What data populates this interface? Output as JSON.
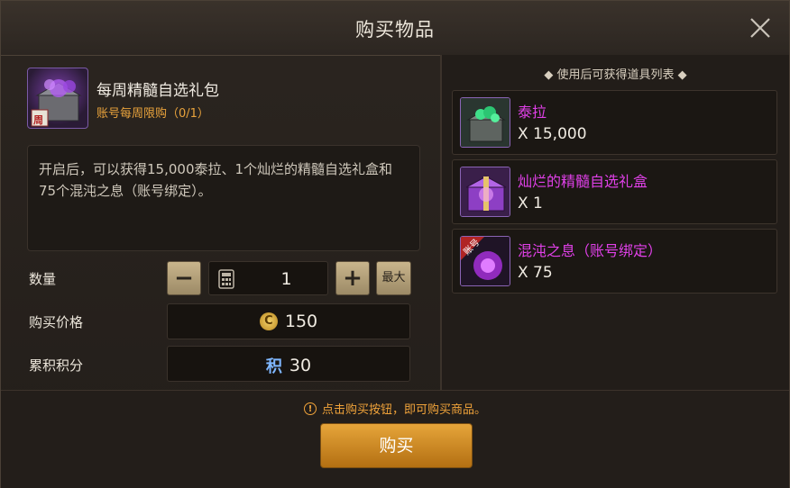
{
  "header": {
    "title": "购买物品"
  },
  "item": {
    "name": "每周精髓自选礼包",
    "limit": "账号每周限购（0/1）",
    "icon_badge": "周",
    "description": "开启后，可以获得15,000泰拉、1个灿烂的精髓自选礼盒和75个混沌之息（账号绑定）。"
  },
  "quantity": {
    "label": "数量",
    "value": "1",
    "minus": "−",
    "plus": "+",
    "max_label": "最大"
  },
  "price": {
    "label": "购买价格",
    "value": "150",
    "currency_glyph": "C"
  },
  "points": {
    "label": "累积积分",
    "value": "30",
    "points_glyph": "积"
  },
  "rewards": {
    "title": "◆ 使用后可获得道具列表 ◆",
    "items": [
      {
        "name": "泰拉",
        "count": "X 15,000",
        "icon": "tera-chest-icon"
      },
      {
        "name": "灿烂的精髓自选礼盒",
        "count": "X 1",
        "icon": "purple-gift-box-icon"
      },
      {
        "name": "混沌之息（账号绑定）",
        "count": "X 75",
        "icon": "chaos-breath-icon",
        "icon_badge": "账号"
      }
    ]
  },
  "footer": {
    "notice_glyph": "!",
    "notice": "点击购买按钮，即可购买商品。",
    "buy_label": "购买"
  },
  "colors": {
    "accent_orange": "#e9a33c",
    "reward_name": "#e040e8",
    "buy_button": "#d08a25"
  }
}
